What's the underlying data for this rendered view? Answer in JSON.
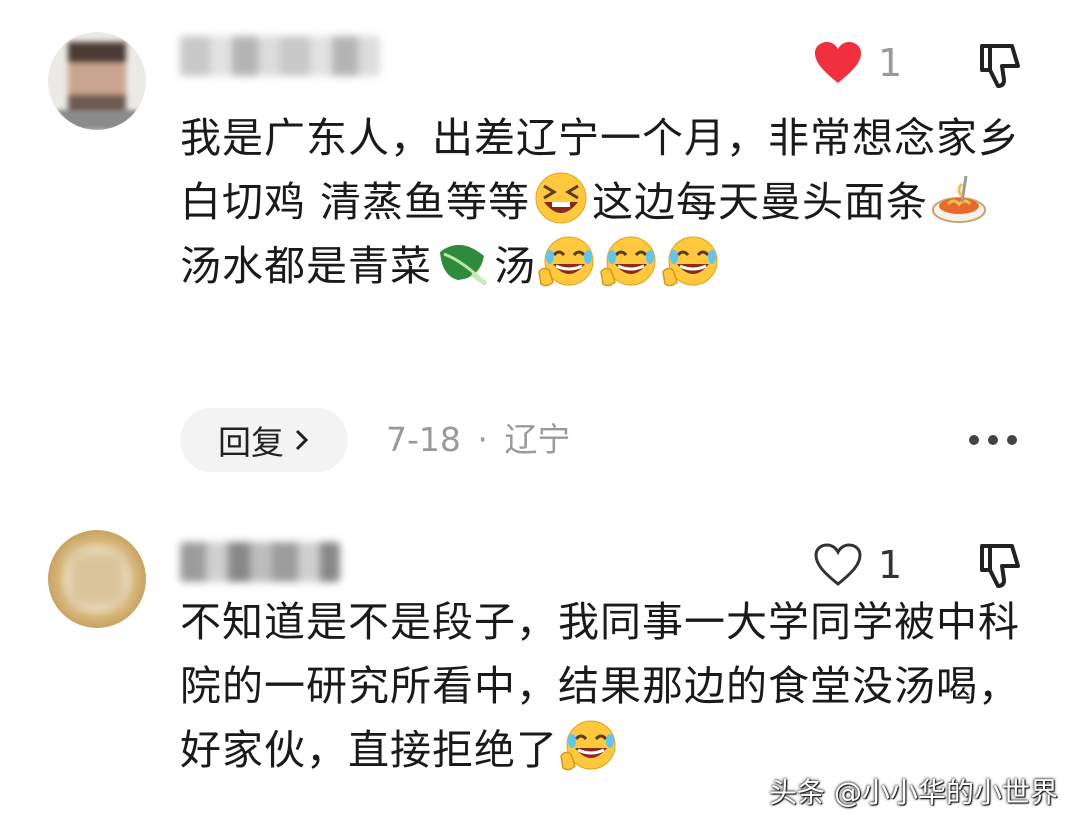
{
  "comments": [
    {
      "like_count": "1",
      "liked": true,
      "text_segments": [
        "我是广东人，出差辽宁一个月，非常想念家乡白切鸡 清蒸鱼等等",
        "这边每天曼头面条",
        "汤水都是青菜",
        "汤"
      ],
      "emojis": [
        "grinning-squint-emoji",
        "spaghetti-emoji",
        "leafy-green-emoji",
        "rolling-laughing-emoji"
      ],
      "reply_label": "回复",
      "date": "7-18",
      "separator": "·",
      "location": "辽宁"
    },
    {
      "like_count": "1",
      "liked": false,
      "text": "不知道是不是段子，我同事一大学同学被中科院的一研究所看中，结果那边的食堂没汤喝，好家伙，直接拒绝了",
      "emojis": [
        "rolling-laughing-emoji"
      ]
    }
  ],
  "watermark": "头条 @小小华的小世界",
  "colors": {
    "heart_active": "#f0313d",
    "meta_gray": "#9a9a9a",
    "reply_bg": "#f3f3f3"
  }
}
